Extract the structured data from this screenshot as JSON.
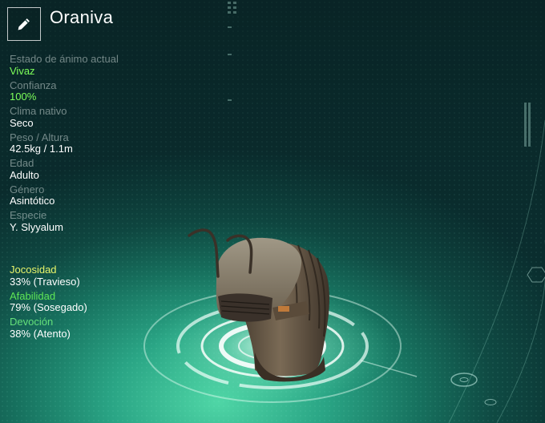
{
  "creature": {
    "name": "Oraniva"
  },
  "stats": [
    {
      "label": "Estado de ánimo actual",
      "value": "Vivaz"
    },
    {
      "label": "Confianza",
      "value": "100%"
    },
    {
      "label": "Clima nativo",
      "value": "Seco"
    },
    {
      "label": "Peso / Altura",
      "value": "42.5kg / 1.1m"
    },
    {
      "label": "Edad",
      "value": "Adulto"
    },
    {
      "label": "Género",
      "value": "Asintótico"
    },
    {
      "label": "Especie",
      "value": "Y. Slyyalum"
    }
  ],
  "traits": [
    {
      "label": "Jocosidad",
      "value": "33% (Travieso)",
      "percent": 33
    },
    {
      "label": "Afabilidad",
      "value": "79% (Sosegado)",
      "percent": 79
    },
    {
      "label": "Devoción",
      "value": "38% (Atento)",
      "percent": 38
    }
  ],
  "colors": {
    "highlight_value": "#7dff5a",
    "trait_jocosidad": "#e8f46a",
    "trait_afabilidad": "#5ee655",
    "trait_devocion": "#64e07a"
  },
  "icons": {
    "edit": "pencil-icon"
  }
}
